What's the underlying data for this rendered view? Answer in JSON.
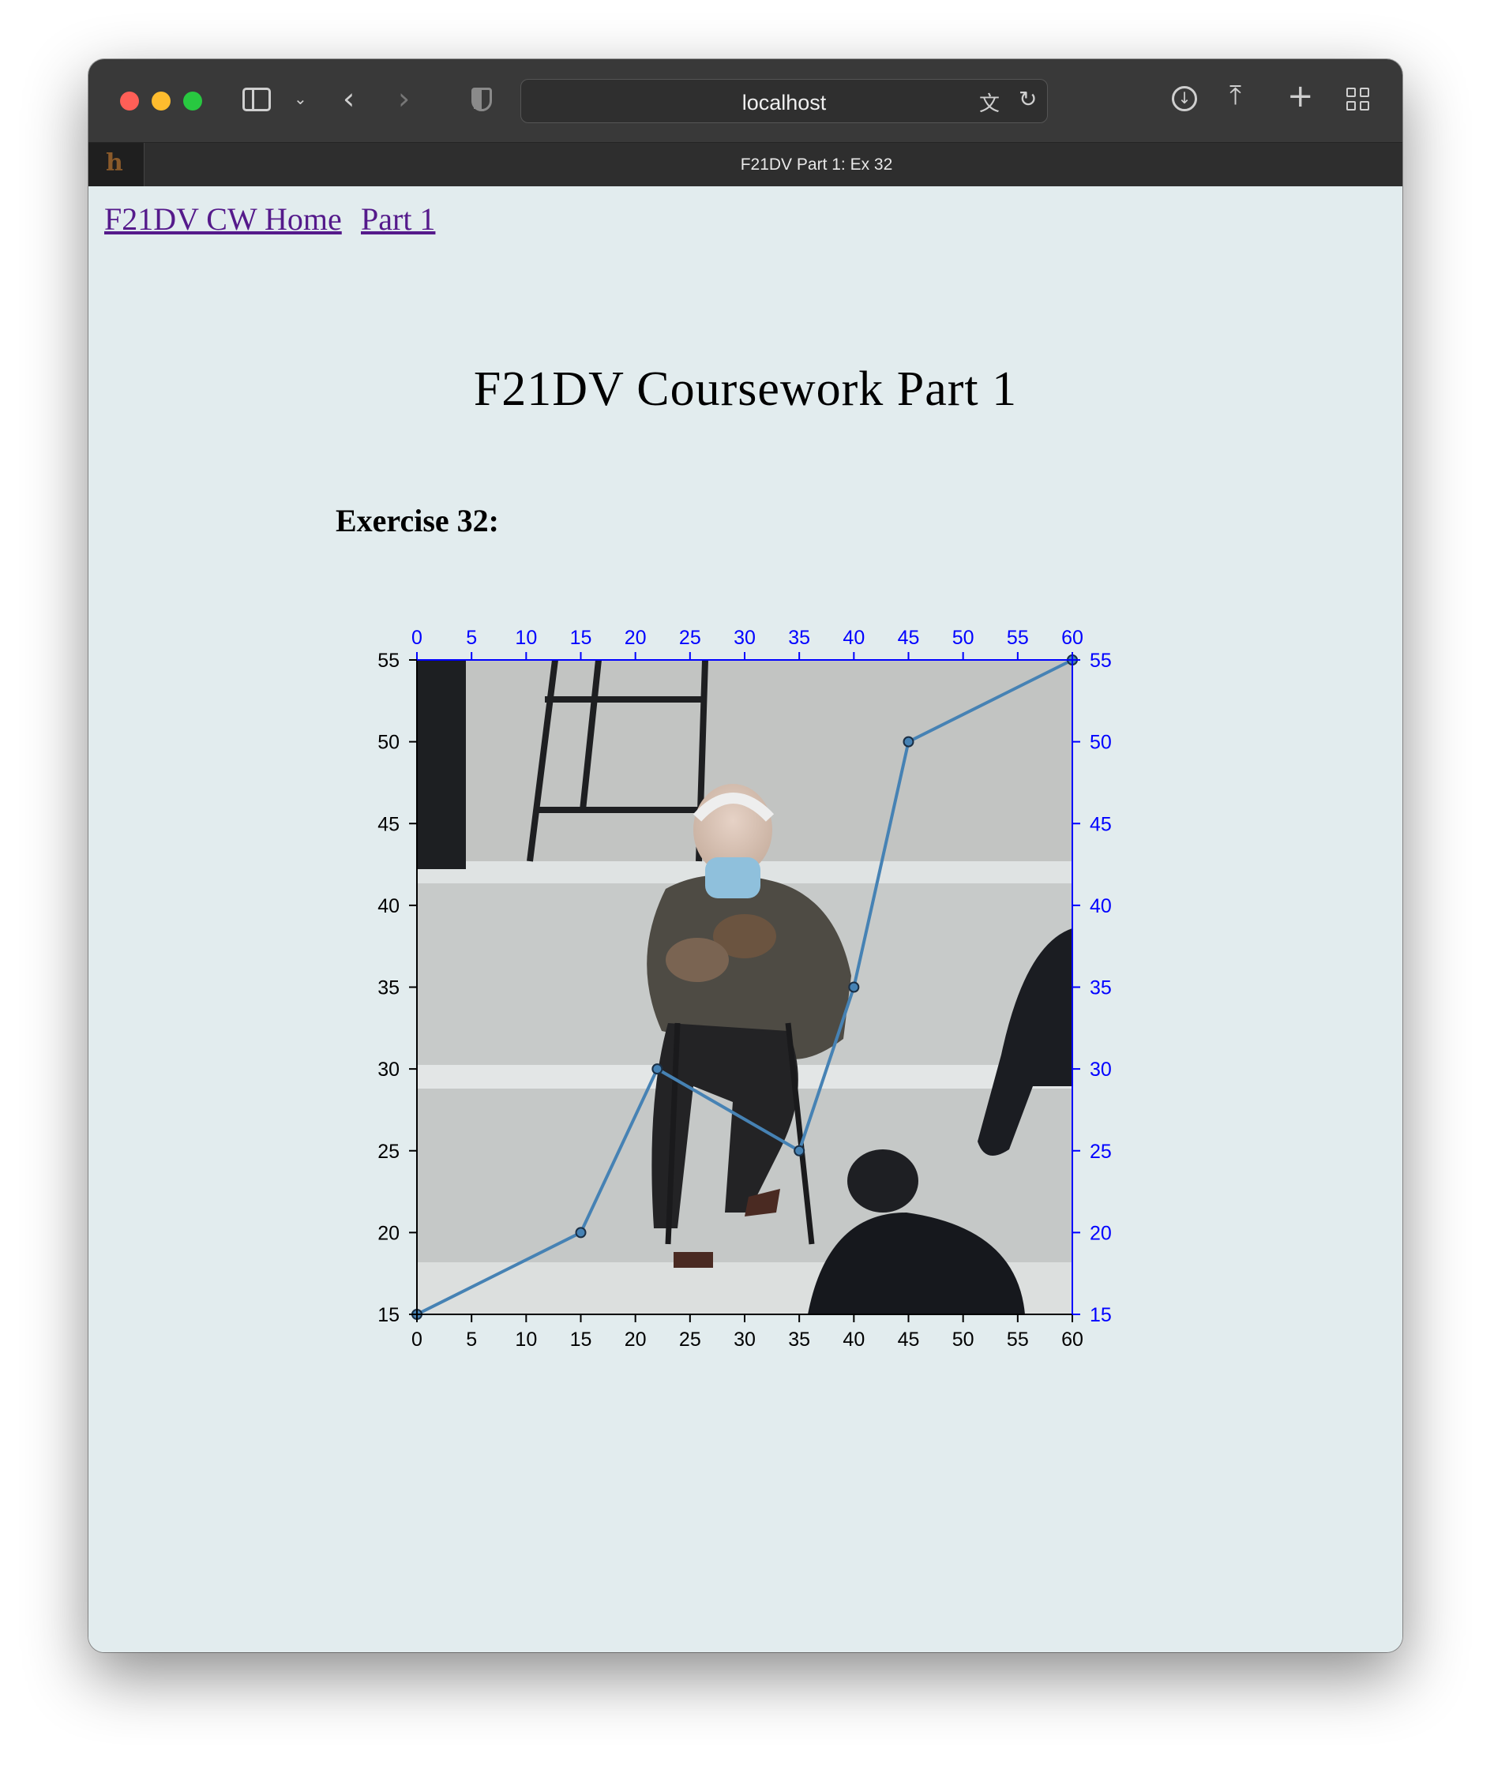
{
  "browser": {
    "url": "localhost",
    "tab_title": "F21DV Part 1: Ex 32",
    "favicon_letter": "h"
  },
  "nav": {
    "home_link": "F21DV CW Home",
    "part_link": "Part 1"
  },
  "page": {
    "heading": "F21DV Coursework Part 1",
    "exercise_title": "Exercise 32:"
  },
  "colors": {
    "line": "#4682b4",
    "right_top_axis": "#0000ff",
    "left_bottom_axis": "#000000",
    "page_background": "#e2ecee"
  },
  "chart_data": {
    "type": "line",
    "background": "photo of a seated man in a parka and mittens wearing a face mask",
    "x": [
      0,
      15,
      22,
      35,
      40,
      45,
      60
    ],
    "y": [
      15,
      20,
      30,
      25,
      35,
      50,
      55
    ],
    "xlim": [
      0,
      60
    ],
    "ylim": [
      15,
      55
    ],
    "x_ticks": [
      0,
      5,
      10,
      15,
      20,
      25,
      30,
      35,
      40,
      45,
      50,
      55,
      60
    ],
    "y_ticks": [
      15,
      20,
      25,
      30,
      35,
      40,
      45,
      50,
      55
    ],
    "axes": [
      "bottom",
      "left",
      "top",
      "right"
    ],
    "grid": false
  }
}
